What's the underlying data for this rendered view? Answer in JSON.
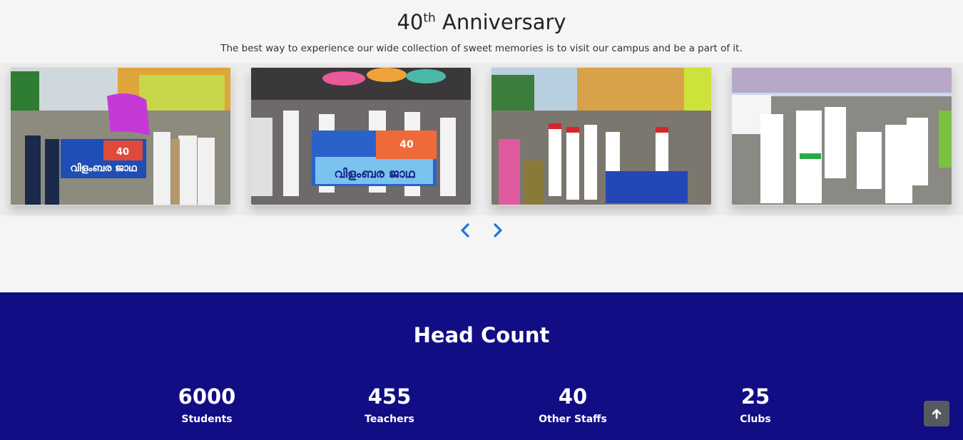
{
  "anniversary": {
    "title_number": "40",
    "title_sup": "th",
    "title_rest": " Anniversary",
    "subtitle": "The best way to experience our wide collection of sweet memories is to visit our campus and be a part of it.",
    "photos": [
      {
        "banner": "വിളംബര ജാഥ",
        "badge": "40"
      },
      {
        "banner": "വിളംബര ജാഥ",
        "badge": "40"
      },
      {
        "banner": "",
        "badge": ""
      },
      {
        "banner": "",
        "badge": ""
      }
    ],
    "prev_icon": "chevron-left-icon",
    "next_icon": "chevron-right-icon",
    "accent": "#1a73e8"
  },
  "head_count": {
    "title": "Head Count",
    "background": "#110d84",
    "stats": [
      {
        "number": "6000",
        "label": "Students"
      },
      {
        "number": "455",
        "label": "Teachers"
      },
      {
        "number": "40",
        "label": "Other Staffs"
      },
      {
        "number": "25",
        "label": "Clubs"
      }
    ]
  },
  "scroll_top_icon": "arrow-up-icon"
}
